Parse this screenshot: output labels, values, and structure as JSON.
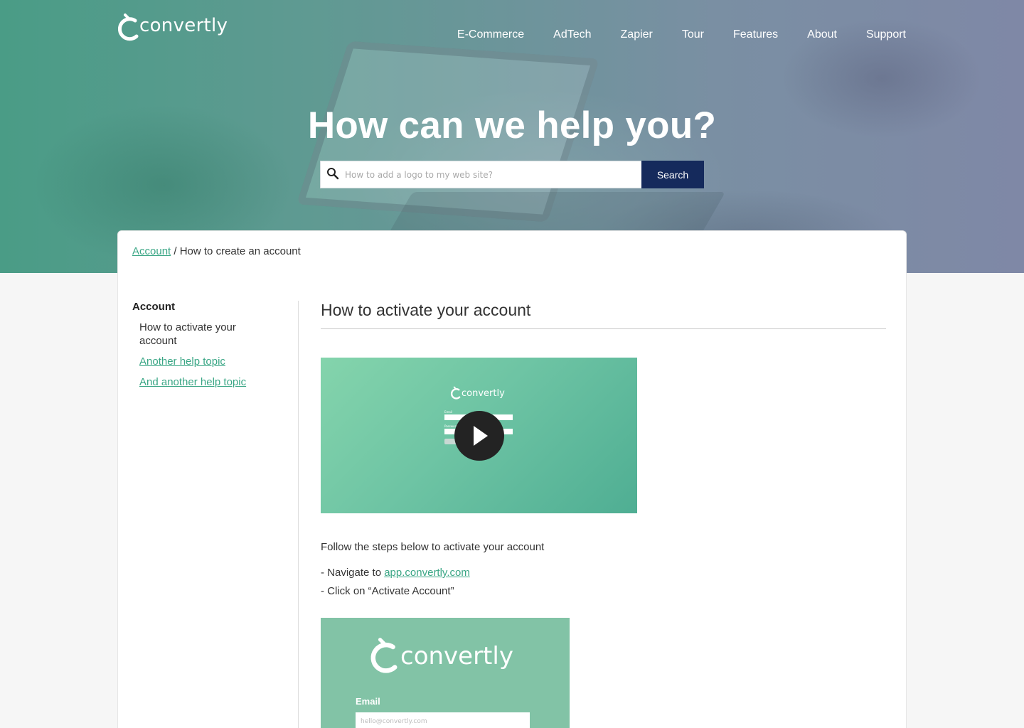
{
  "brand": {
    "name": "convertly",
    "accent": "#3aa685",
    "dark_button": "#152a5c"
  },
  "nav": {
    "items": [
      "E-Commerce",
      "AdTech",
      "Zapier",
      "Tour",
      "Features",
      "About",
      "Support"
    ]
  },
  "hero": {
    "title": "How can we help you?",
    "search_placeholder": "How to add a logo to my web site?",
    "search_button": "Search"
  },
  "breadcrumb": {
    "parent": "Account",
    "separator": " / ",
    "current": "How to create an account"
  },
  "sidebar": {
    "title": "Account",
    "items": [
      {
        "label": "How to activate your account",
        "link": false
      },
      {
        "label": "Another help topic",
        "link": true
      },
      {
        "label": "And another help topic",
        "link": true
      }
    ]
  },
  "article": {
    "title": "How to activate your account",
    "video": {
      "logo_text": "convertly",
      "email_label": "Email",
      "password_label": "Password",
      "login_label": "Login"
    },
    "intro": "Follow the steps below to activate your account",
    "step1_prefix": "- Navigate to ",
    "step1_link": "app.convertly.com",
    "step2": "- Click on “Activate Account”",
    "screenshot": {
      "logo_text": "convertly",
      "email_label": "Email",
      "email_placeholder": "hello@convertly.com"
    }
  }
}
